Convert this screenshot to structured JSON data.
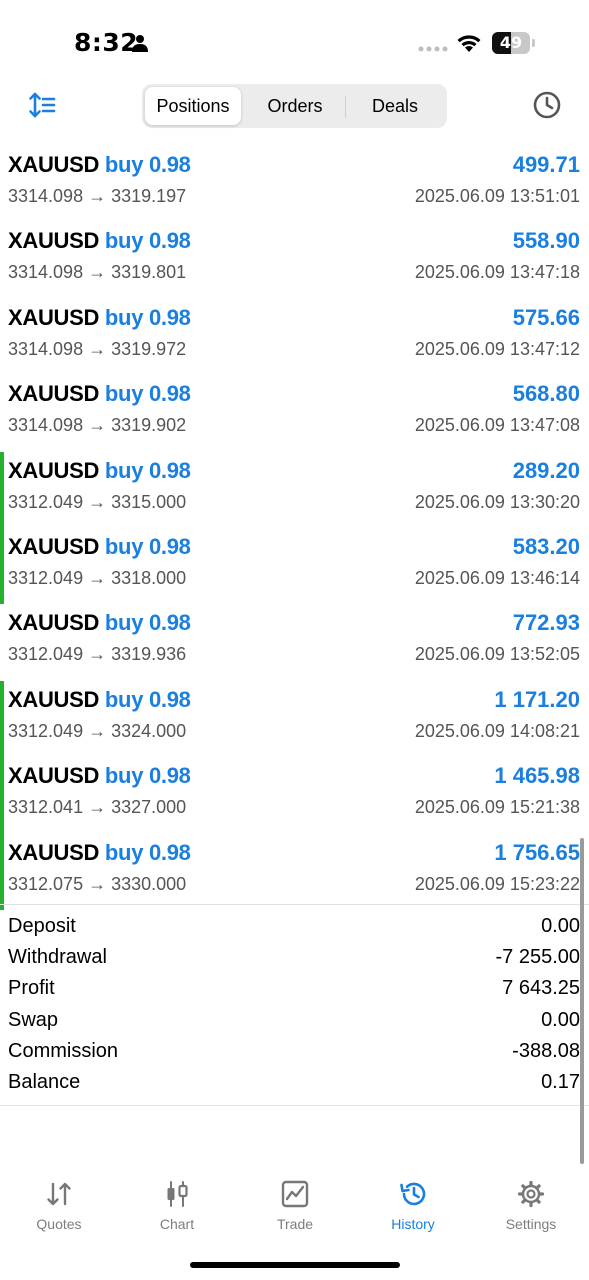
{
  "status_bar": {
    "time": "8:32",
    "battery": "49",
    "battery_level": 0.49
  },
  "header": {
    "tabs": [
      {
        "label": "Positions",
        "active": true
      },
      {
        "label": "Orders",
        "active": false
      },
      {
        "label": "Deals",
        "active": false
      }
    ],
    "sort_icon": "sort-icon",
    "history_icon": "clock-icon"
  },
  "deals": [
    {
      "symbol": "XAUUSD",
      "side": "buy 0.98",
      "profit": "499.71",
      "prices": "3314.098 → 3319.197",
      "time": "2025.06.09 13:51:01",
      "marked": false
    },
    {
      "symbol": "XAUUSD",
      "side": "buy 0.98",
      "profit": "558.90",
      "prices": "3314.098 → 3319.801",
      "time": "2025.06.09 13:47:18",
      "marked": false
    },
    {
      "symbol": "XAUUSD",
      "side": "buy 0.98",
      "profit": "575.66",
      "prices": "3314.098 → 3319.972",
      "time": "2025.06.09 13:47:12",
      "marked": false
    },
    {
      "symbol": "XAUUSD",
      "side": "buy 0.98",
      "profit": "568.80",
      "prices": "3314.098 → 3319.902",
      "time": "2025.06.09 13:47:08",
      "marked": false
    },
    {
      "symbol": "XAUUSD",
      "side": "buy 0.98",
      "profit": "289.20",
      "prices": "3312.049 → 3315.000",
      "time": "2025.06.09 13:30:20",
      "marked": true
    },
    {
      "symbol": "XAUUSD",
      "side": "buy 0.98",
      "profit": "583.20",
      "prices": "3312.049 → 3318.000",
      "time": "2025.06.09 13:46:14",
      "marked": true
    },
    {
      "symbol": "XAUUSD",
      "side": "buy 0.98",
      "profit": "772.93",
      "prices": "3312.049 → 3319.936",
      "time": "2025.06.09 13:52:05",
      "marked": false
    },
    {
      "symbol": "XAUUSD",
      "side": "buy 0.98",
      "profit": "1 171.20",
      "prices": "3312.049 → 3324.000",
      "time": "2025.06.09 14:08:21",
      "marked": true
    },
    {
      "symbol": "XAUUSD",
      "side": "buy 0.98",
      "profit": "1 465.98",
      "prices": "3312.041 → 3327.000",
      "time": "2025.06.09 15:21:38",
      "marked": true
    },
    {
      "symbol": "XAUUSD",
      "side": "buy 0.98",
      "profit": "1 756.65",
      "prices": "3312.075 → 3330.000",
      "time": "2025.06.09 15:23:22",
      "marked": true
    }
  ],
  "summary": [
    {
      "label": "Deposit",
      "value": "0.00"
    },
    {
      "label": "Withdrawal",
      "value": "-7 255.00"
    },
    {
      "label": "Profit",
      "value": "7 643.25"
    },
    {
      "label": "Swap",
      "value": "0.00"
    },
    {
      "label": "Commission",
      "value": "-388.08"
    },
    {
      "label": "Balance",
      "value": "0.17"
    }
  ],
  "tabbar": [
    {
      "label": "Quotes",
      "icon": "quotes-icon",
      "active": false
    },
    {
      "label": "Chart",
      "icon": "chart-icon",
      "active": false
    },
    {
      "label": "Trade",
      "icon": "trade-icon",
      "active": false
    },
    {
      "label": "History",
      "icon": "history-icon",
      "active": true
    },
    {
      "label": "Settings",
      "icon": "gear-icon",
      "active": false
    }
  ],
  "colors": {
    "accent": "#1a7fde",
    "marker_green": "#25b02d",
    "secondary_text": "#555555"
  }
}
